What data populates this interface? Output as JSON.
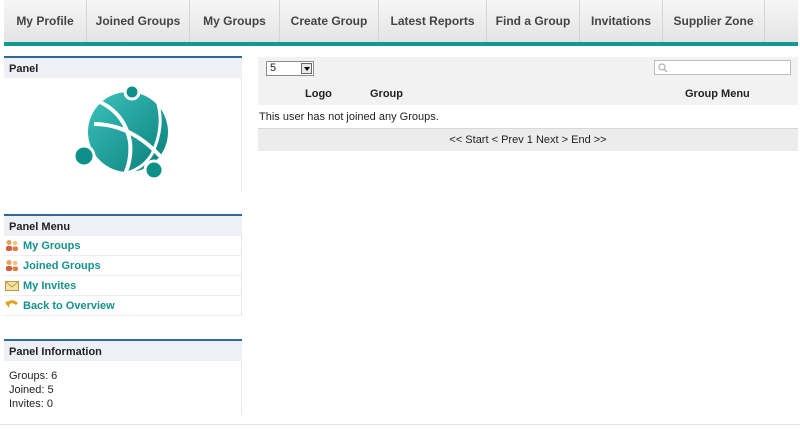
{
  "nav": {
    "tabs": [
      "My Profile",
      "Joined Groups",
      "My Groups",
      "Create Group",
      "Latest Reports",
      "Find a Group",
      "Invitations",
      "Supplier Zone"
    ],
    "accent_color": "#109a96"
  },
  "panel": {
    "title": "Panel"
  },
  "panel_menu": {
    "title": "Panel Menu",
    "items": [
      {
        "label": "My Groups",
        "icon": "users-icon"
      },
      {
        "label": "Joined Groups",
        "icon": "users-icon"
      },
      {
        "label": "My Invites",
        "icon": "envelope-icon"
      },
      {
        "label": "Back to Overview",
        "icon": "back-arrow-icon"
      }
    ]
  },
  "panel_info": {
    "title": "Panel Information",
    "lines": [
      "Groups: 6",
      "Joined: 5",
      "Invites: 0"
    ]
  },
  "main": {
    "page_size": "5",
    "columns": [
      "Logo",
      "Group",
      "Group Menu"
    ],
    "empty_message": "This user has not joined any Groups.",
    "pager": [
      "<< Start",
      "< Prev",
      "1",
      "Next >",
      "End >>"
    ]
  }
}
